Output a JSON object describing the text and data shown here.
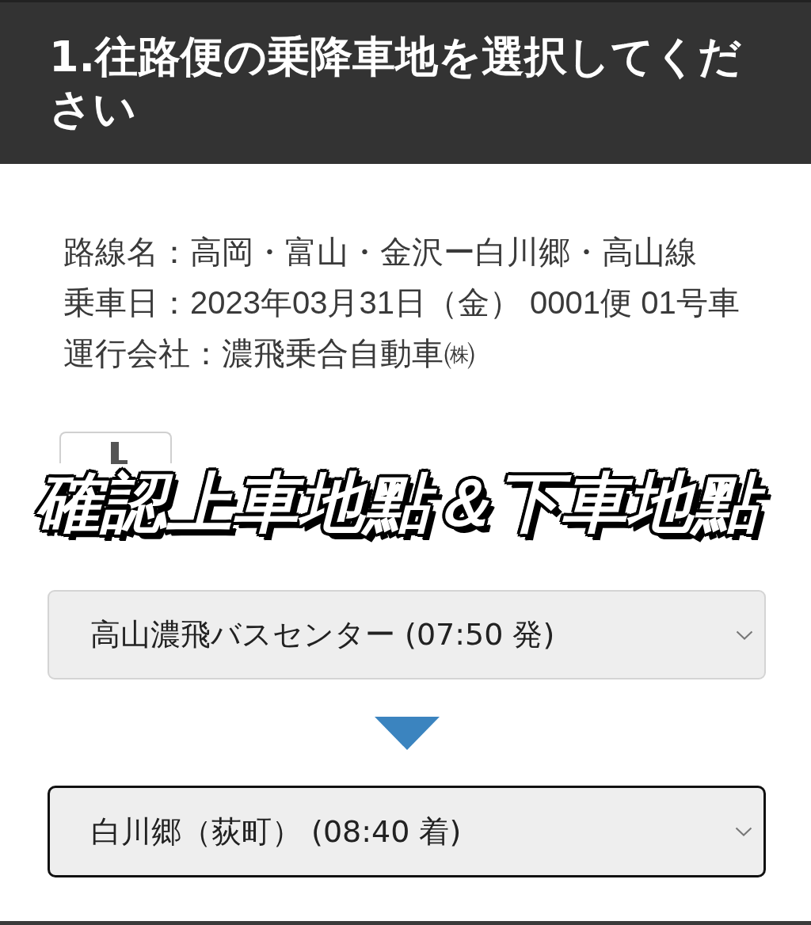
{
  "header": {
    "title": "1.往路便の乗降車地を選択してください"
  },
  "route_info": [
    "路線名：高岡・富山・金沢ー白川郷・高山線",
    "乗車日：2023年03月31日（金） 0001便 01号車",
    "運行会社：濃飛乗合自動車㈱"
  ],
  "caption": "確認上車地點＆下車地點",
  "stop_selects": [
    {
      "value": "高山濃飛バスセンター (07:50 発)",
      "focused": false
    },
    {
      "value": "白川郷（荻町） (08:40 着)",
      "focused": true
    }
  ]
}
